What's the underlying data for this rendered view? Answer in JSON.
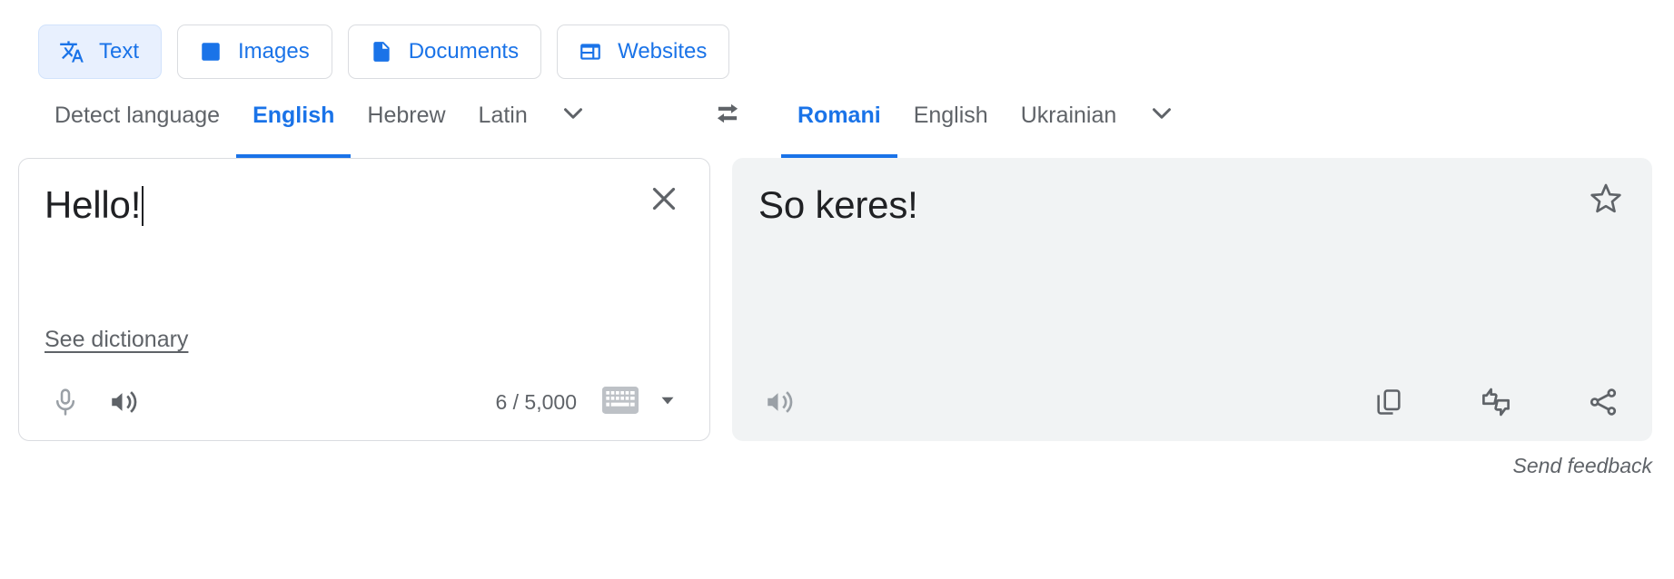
{
  "modes": [
    {
      "label": "Text",
      "icon": "translate-icon",
      "active": true
    },
    {
      "label": "Images",
      "icon": "image-icon",
      "active": false
    },
    {
      "label": "Documents",
      "icon": "document-icon",
      "active": false
    },
    {
      "label": "Websites",
      "icon": "website-icon",
      "active": false
    }
  ],
  "source_languages": {
    "items": [
      {
        "label": "Detect language",
        "active": false
      },
      {
        "label": "English",
        "active": true
      },
      {
        "label": "Hebrew",
        "active": false
      },
      {
        "label": "Latin",
        "active": false
      }
    ],
    "more_icon": "chevron-down-icon"
  },
  "swap": {
    "icon": "swap-horizontal-icon"
  },
  "target_languages": {
    "items": [
      {
        "label": "Romani",
        "active": true
      },
      {
        "label": "English",
        "active": false
      },
      {
        "label": "Ukrainian",
        "active": false
      }
    ],
    "more_icon": "chevron-down-icon"
  },
  "source_panel": {
    "text": "Hello!",
    "placeholder": "Enter text",
    "clear_icon": "close-icon",
    "dictionary_label": "See dictionary",
    "mic_icon": "microphone-icon",
    "listen_icon": "speaker-icon",
    "char_count": "6 / 5,000",
    "keyboard_icon": "keyboard-icon",
    "keyboard_caret_icon": "caret-down-icon"
  },
  "target_panel": {
    "text": "So keres!",
    "star_icon": "star-outline-icon",
    "listen_icon": "speaker-icon",
    "copy_icon": "copy-icon",
    "rate_icon": "thumbs-rate-icon",
    "share_icon": "share-icon"
  },
  "feedback": {
    "label": "Send feedback"
  },
  "colors": {
    "accent": "#1a73e8",
    "active_chip_bg": "#e8f0fe",
    "target_panel_bg": "#f1f3f4",
    "border": "#dadce0",
    "muted_text": "#5f6368"
  }
}
